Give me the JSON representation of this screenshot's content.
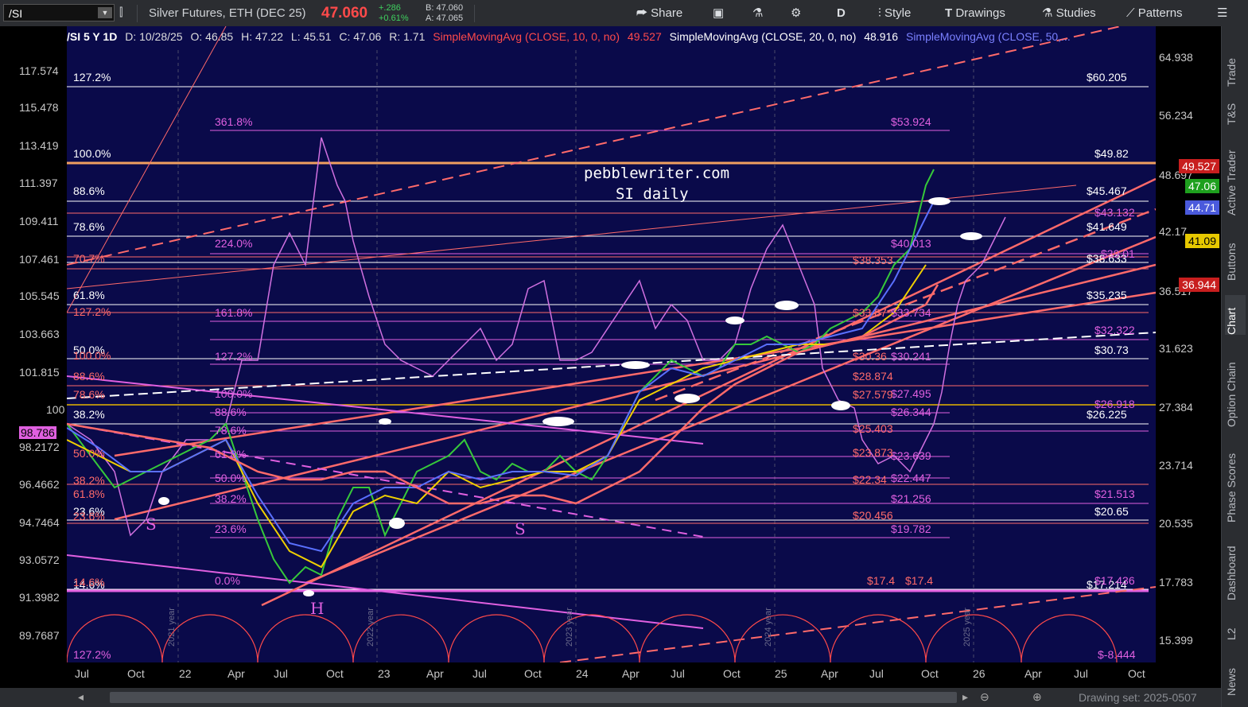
{
  "toolbar": {
    "symbol": "/SI",
    "instrument": "Silver Futures, ETH (DEC 25)",
    "last": "47.060",
    "change": "+.286",
    "change_pct": "+0.61%",
    "bid": "B: 47.060",
    "ask": "A: 47.065",
    "share": "Share",
    "period": "D",
    "style": "Style",
    "drawings": "Drawings",
    "studies": "Studies",
    "patterns": "Patterns"
  },
  "info": {
    "symbol_period": "/SI 5 Y 1D",
    "date": "D: 10/28/25",
    "open": "O: 46.85",
    "high": "H: 47.22",
    "low": "L: 45.51",
    "close": "C: 47.06",
    "range": "R: 1.71",
    "sma10": "SimpleMovingAvg (CLOSE, 10, 0, no)",
    "sma10_val": "49.527",
    "sma20": "SimpleMovingAvg (CLOSE, 20, 0, no)",
    "sma20_val": "48.916",
    "sma50": "SimpleMovingAvg (CLOSE, 50,..."
  },
  "watermark": {
    "line1": "pebblewriter.com",
    "line2": "SI daily"
  },
  "left_axis": [
    "117.574",
    "115.478",
    "113.419",
    "111.397",
    "109.411",
    "107.461",
    "105.545",
    "103.663",
    "101.815",
    "100",
    "98.2172",
    "96.4662",
    "94.7464",
    "93.0572",
    "91.3982",
    "89.7687"
  ],
  "left_highlight": "98.786",
  "right_axis": [
    "64.938",
    "56.234",
    "48.697",
    "42.17",
    "36.517",
    "31.623",
    "27.384",
    "23.714",
    "20.535",
    "17.783",
    "15.399"
  ],
  "tags": [
    {
      "label": "49.527",
      "color": "#c81e1e"
    },
    {
      "label": "47.06",
      "color": "#1ea01e"
    },
    {
      "label": "44.71",
      "color": "#4a5adc"
    },
    {
      "label": "41.09",
      "color": "#e6c800",
      "text": "#000"
    },
    {
      "label": "36.944",
      "color": "#c81e1e"
    }
  ],
  "x_axis": [
    "Jul",
    "Oct",
    "22",
    "Apr",
    "Jul",
    "Oct",
    "23",
    "Apr",
    "Jul",
    "Oct",
    "24",
    "Apr",
    "Jul",
    "Oct",
    "25",
    "Apr",
    "Jul",
    "Oct",
    "26",
    "Apr",
    "Jul",
    "Oct"
  ],
  "year_marks": [
    "2021 year",
    "2022 year",
    "2023 year",
    "2024 year",
    "2025 year"
  ],
  "fib_left_white": [
    "127.2%",
    "100.0%",
    "88.6%",
    "78.6%",
    "61.8%",
    "50.0%",
    "38.2%",
    "23.6%",
    "14.6%",
    "127.2%"
  ],
  "fib_left_pink": [
    "361.8%",
    "224.0%",
    "161.8%",
    "127.2%",
    "100.0%",
    "88.6%",
    "78.6%",
    "61.8%",
    "50.0%",
    "38.2%",
    "23.6%",
    "0.0%"
  ],
  "fib_left_salmon": [
    "127.2%",
    "100.0%",
    "88.6%",
    "78.6%",
    "70.7%",
    "61.8%",
    "50.0%",
    "38.2%",
    "23.6%",
    "14.6%"
  ],
  "price_labels_white": [
    "$60.205",
    "$49.82",
    "$45.467",
    "$41.649",
    "$38.633",
    "$35.235",
    "$30.73",
    "$26.225",
    "$20.65",
    "$17.214"
  ],
  "price_labels_pink": [
    "$53.924",
    "$43.132",
    "$40.013",
    "$33.734",
    "$32.322",
    "$30.241",
    "$27.495",
    "$26.344",
    "$23.639",
    "$22.447",
    "$21.256",
    "$19.782",
    "$21.513",
    "$17.436",
    "$-8.444",
    "$39.01",
    "$26.918"
  ],
  "price_labels_salmon": [
    "$38.353",
    "$33.87",
    "$30.36",
    "$28.874",
    "$27.579",
    "$25.403",
    "$23.873",
    "$22.34",
    "$20.456",
    "$17.4",
    "$17.4"
  ],
  "pattern_labels": [
    "S",
    "H",
    "S"
  ],
  "sidebar": [
    "Trade",
    "T&S",
    "Active Trader",
    "Buttons",
    "Chart",
    "Option Chain",
    "Phase Scores",
    "Dashboard",
    "L2",
    "News"
  ],
  "drawing_set": "Drawing set: 2025-0507"
}
